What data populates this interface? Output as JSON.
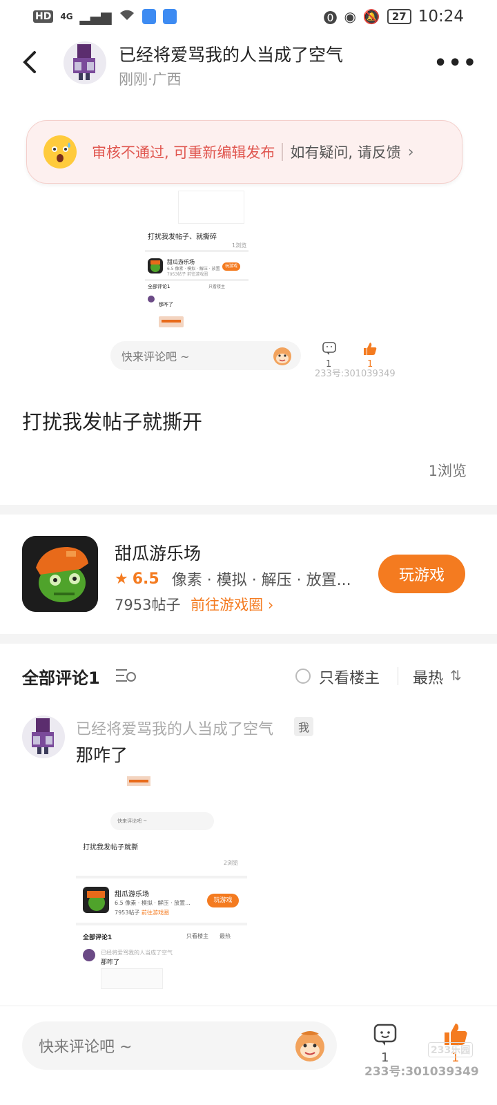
{
  "status_bar": {
    "hd": "HD",
    "network": "4G",
    "battery": "27",
    "time": "10:24"
  },
  "header": {
    "title": "已经将爱骂我的人当成了空气",
    "subtitle": "刚刚·广西"
  },
  "review_banner": {
    "status_text": "审核不通过, 可重新编辑发布",
    "feedback_text": "如有疑问, 请反馈"
  },
  "embedded_top": {
    "post_text": "打扰我发帖子、就撕碎",
    "views": "1浏览",
    "game_name": "甜瓜游乐场",
    "game_tags": "6.5  像素 · 模拟 · 解压 · 放置",
    "game_posts": "7953帖子  前往游戏圈",
    "play": "玩游戏",
    "comments_title": "全部评论1",
    "only_owner": "只看楼主",
    "comment_text": "那咋了",
    "comment_placeholder": "快来评论吧 ~",
    "count_comment": "1",
    "count_like": "1",
    "watermark": "233号:301039349"
  },
  "post": {
    "content": "打扰我发帖子就撕开",
    "views": "1浏览"
  },
  "game_card": {
    "name": "甜瓜游乐场",
    "rating": "6.5",
    "tags": "像素 · 模拟 · 解压 · 放置...",
    "posts": "7953帖子",
    "link": "前往游戏圈",
    "play_button": "玩游戏"
  },
  "comments_header": {
    "title": "全部评论1",
    "only_owner": "只看楼主",
    "sort": "最热"
  },
  "comment": {
    "author": "已经将爱骂我的人当成了空气",
    "me_badge": "我",
    "text": "那咋了"
  },
  "embedded_bottom": {
    "comment_placeholder": "快来评论吧 ~",
    "post_text": "打扰我发帖子就撕",
    "views": "2浏览",
    "game_name": "甜瓜游乐场",
    "game_tags": "6.5  像素 · 模拟 · 解压 · 放置...",
    "game_posts": "7953帖子",
    "game_link": "前往游戏圈",
    "play": "玩游戏",
    "comments_title": "全部评论1",
    "only_owner": "只看楼主",
    "sort": "最热",
    "comment_author": "已经将爱骂我的人当成了空气",
    "comment_text": "那咋了"
  },
  "bottom_bar": {
    "placeholder": "快来评论吧 ~",
    "comment_count": "1",
    "like_count": "1",
    "watermark": "233号:301039349",
    "watermark_logo": "233乐园"
  },
  "colors": {
    "accent": "#f47b20",
    "fail_red": "#e0564f",
    "banner_bg": "#fdf0ef"
  },
  "icons": [
    "back-arrow-icon",
    "more-dots-icon",
    "surprised-face-icon",
    "chevron-right-icon",
    "star-icon",
    "sort-icon",
    "radio-icon",
    "comment-bubble-icon",
    "thumb-up-icon",
    "monkey-face-icon"
  ]
}
